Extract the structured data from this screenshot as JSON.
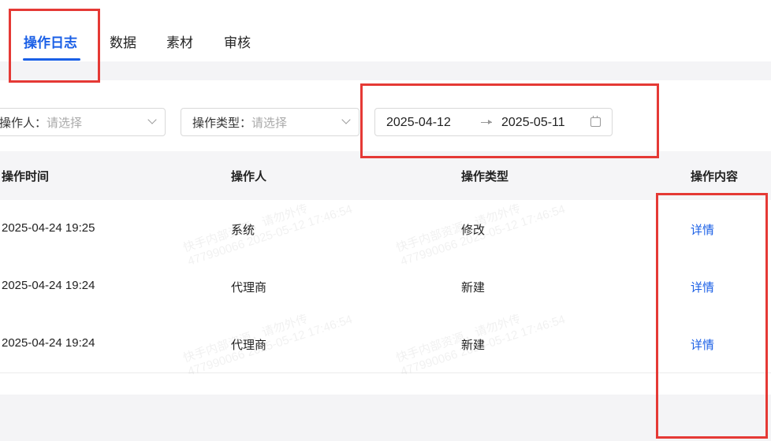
{
  "tabs": [
    {
      "label": "操作日志",
      "active": true
    },
    {
      "label": "数据",
      "active": false
    },
    {
      "label": "素材",
      "active": false
    },
    {
      "label": "审核",
      "active": false
    }
  ],
  "filters": {
    "operator": {
      "label": "操作人：",
      "placeholder": "请选择"
    },
    "op_type": {
      "label": "操作类型：",
      "placeholder": "请选择"
    },
    "date_range": {
      "start": "2025-04-12",
      "end": "2025-05-11"
    }
  },
  "table": {
    "headers": [
      "操作时间",
      "操作人",
      "操作类型",
      "操作内容"
    ],
    "rows": [
      {
        "time": "2025-04-24 19:25",
        "operator": "系统",
        "type": "修改",
        "content": "详情"
      },
      {
        "time": "2025-04-24 19:24",
        "operator": "代理商",
        "type": "新建",
        "content": "详情"
      },
      {
        "time": "2025-04-24 19:24",
        "operator": "代理商",
        "type": "新建",
        "content": "详情"
      }
    ]
  },
  "watermark": {
    "line1": "快手内部资源，请勿外传",
    "line2": "477990066 2025-05-12 17:46:54"
  },
  "colors": {
    "accent": "#1a5fe6",
    "highlight_box": "#e53935"
  }
}
